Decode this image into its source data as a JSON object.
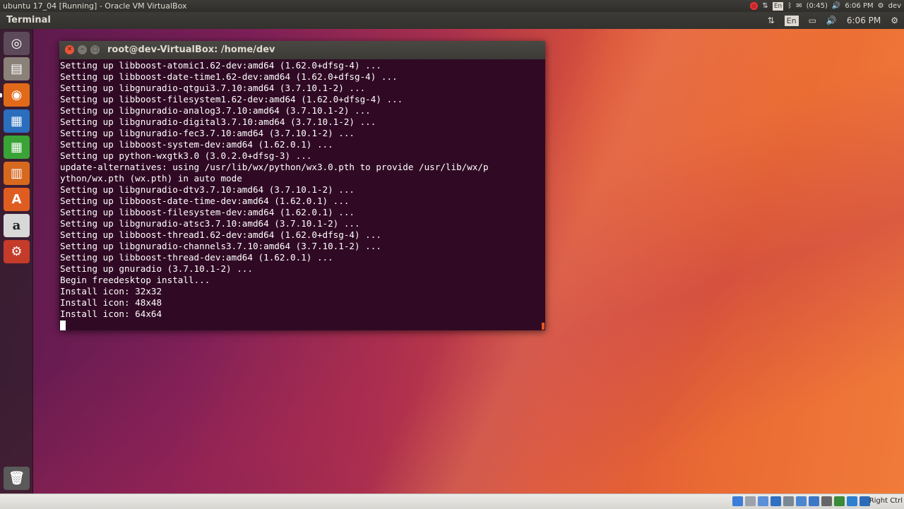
{
  "host": {
    "title": "ubuntu 17_04 [Running] - Oracle VM VirtualBox",
    "tray": {
      "lang": "En",
      "battery": "(0:45)",
      "clock": "6:06 PM",
      "user": "dev"
    },
    "status_host_key": "Right Ctrl"
  },
  "panel": {
    "app_name": "Terminal",
    "lang": "En",
    "clock": "6:06 PM"
  },
  "launcher": {
    "amazon_glyph": "a",
    "software_glyph": "A"
  },
  "terminal": {
    "title": "root@dev-VirtualBox: /home/dev",
    "lines": [
      "Setting up libboost-atomic1.62-dev:amd64 (1.62.0+dfsg-4) ...",
      "Setting up libboost-date-time1.62-dev:amd64 (1.62.0+dfsg-4) ...",
      "Setting up libgnuradio-qtgui3.7.10:amd64 (3.7.10.1-2) ...",
      "Setting up libboost-filesystem1.62-dev:amd64 (1.62.0+dfsg-4) ...",
      "Setting up libgnuradio-analog3.7.10:amd64 (3.7.10.1-2) ...",
      "Setting up libgnuradio-digital3.7.10:amd64 (3.7.10.1-2) ...",
      "Setting up libgnuradio-fec3.7.10:amd64 (3.7.10.1-2) ...",
      "Setting up libboost-system-dev:amd64 (1.62.0.1) ...",
      "Setting up python-wxgtk3.0 (3.0.2.0+dfsg-3) ...",
      "update-alternatives: using /usr/lib/wx/python/wx3.0.pth to provide /usr/lib/wx/p",
      "ython/wx.pth (wx.pth) in auto mode",
      "Setting up libgnuradio-dtv3.7.10:amd64 (3.7.10.1-2) ...",
      "Setting up libboost-date-time-dev:amd64 (1.62.0.1) ...",
      "Setting up libboost-filesystem-dev:amd64 (1.62.0.1) ...",
      "Setting up libgnuradio-atsc3.7.10:amd64 (3.7.10.1-2) ...",
      "Setting up libboost-thread1.62-dev:amd64 (1.62.0+dfsg-4) ...",
      "Setting up libgnuradio-channels3.7.10:amd64 (3.7.10.1-2) ...",
      "Setting up libboost-thread-dev:amd64 (1.62.0.1) ...",
      "Setting up gnuradio (3.7.10.1-2) ...",
      "Begin freedesktop install...",
      "Install icon: 32x32",
      "Install icon: 48x48",
      "Install icon: 64x64"
    ]
  }
}
